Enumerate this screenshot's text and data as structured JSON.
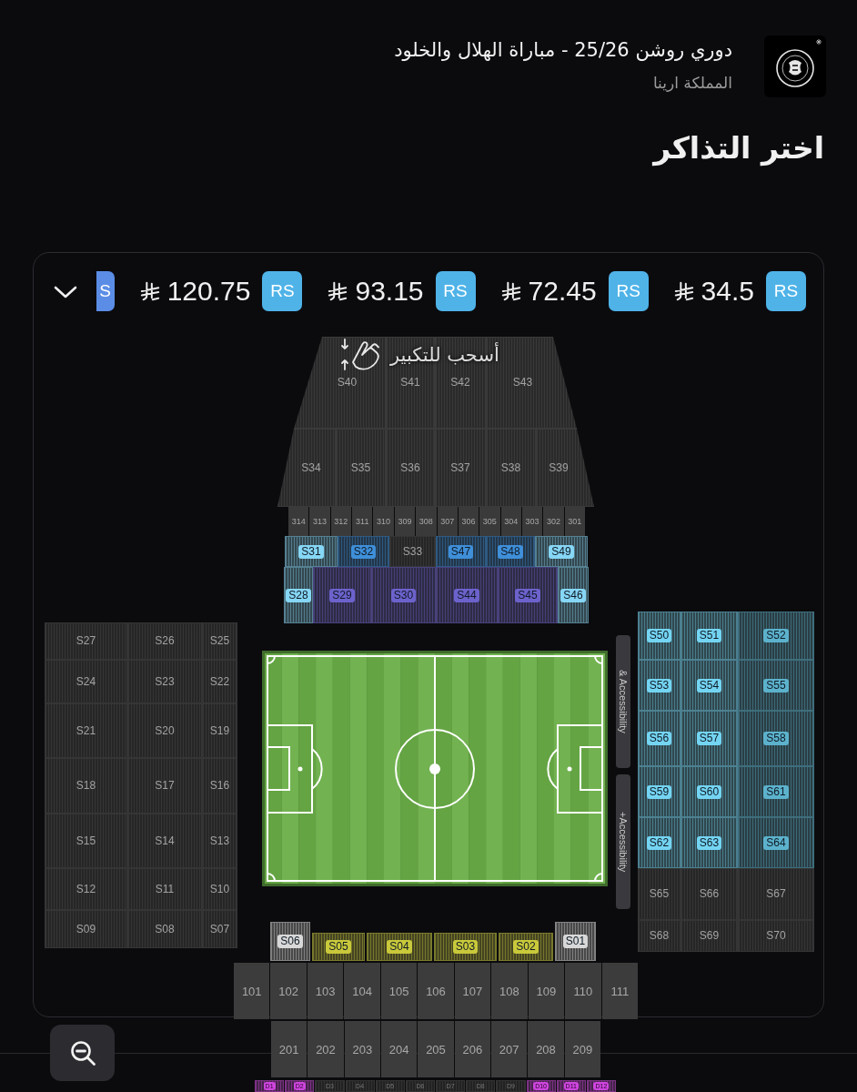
{
  "event": {
    "title": "دوري روشن 25/26 - مباراة الهلال والخلود",
    "venue": "المملكة ارينا"
  },
  "heading": "اختر التذاكر",
  "price_filters": [
    {
      "badge": "S",
      "color": "#5b8de6"
    },
    {
      "badge": "RS",
      "price": "120.75",
      "color": "#4fb3e8"
    },
    {
      "badge": "RS",
      "price": "93.15",
      "color": "#4fb3e8"
    },
    {
      "badge": "RS",
      "price": "72.45",
      "color": "#4fb3e8"
    },
    {
      "badge": "RS",
      "price": "34.5",
      "color": "#4fb3e8"
    }
  ],
  "map": {
    "hint": "أسحب للتكبير",
    "top_stand": {
      "upper_tier": [
        {
          "label": "S40",
          "available": false
        },
        {
          "label": "S41",
          "available": false
        },
        {
          "label": "S42",
          "available": false
        },
        {
          "label": "S43",
          "available": false
        }
      ],
      "lower_tier": [
        {
          "label": "S34",
          "available": false
        },
        {
          "label": "S35",
          "available": false
        },
        {
          "label": "S36",
          "available": false
        },
        {
          "label": "S37",
          "available": false
        },
        {
          "label": "S38",
          "available": false
        },
        {
          "label": "S39",
          "available": false
        }
      ],
      "boxes": [
        {
          "label": "314",
          "available": false
        },
        {
          "label": "313",
          "available": false
        },
        {
          "label": "312",
          "available": false
        },
        {
          "label": "311",
          "available": false
        },
        {
          "label": "310",
          "available": false
        },
        {
          "label": "309",
          "available": false
        },
        {
          "label": "308",
          "available": false
        },
        {
          "label": "307",
          "available": false
        },
        {
          "label": "306",
          "available": false
        },
        {
          "label": "305",
          "available": false
        },
        {
          "label": "304",
          "available": false
        },
        {
          "label": "303",
          "available": false
        },
        {
          "label": "302",
          "available": false
        },
        {
          "label": "301",
          "available": false
        }
      ],
      "front_tier": [
        {
          "label": "S31",
          "available": true,
          "color": "#86d6f5"
        },
        {
          "label": "S32",
          "available": true,
          "color": "#3f8fd9"
        },
        {
          "label": "S33",
          "available": false
        },
        {
          "label": "S47",
          "available": true,
          "color": "#3f8fd9"
        },
        {
          "label": "S48",
          "available": true,
          "color": "#3f8fd9"
        },
        {
          "label": "S49",
          "available": true,
          "color": "#86d6f5"
        }
      ],
      "pitchside_tier": [
        {
          "label": "S28",
          "available": true,
          "color": "#86d6f5"
        },
        {
          "label": "S29",
          "available": true,
          "color": "#6d62cc"
        },
        {
          "label": "S30",
          "available": true,
          "color": "#6d62cc"
        },
        {
          "label": "S44",
          "available": true,
          "color": "#6d62cc"
        },
        {
          "label": "S45",
          "available": true,
          "color": "#6d62cc"
        },
        {
          "label": "S46",
          "available": true,
          "color": "#86d6f5"
        }
      ]
    },
    "left_stand": {
      "rows": [
        [
          {
            "label": "S27",
            "available": false
          },
          {
            "label": "S26",
            "available": false
          },
          {
            "label": "S25",
            "available": false
          }
        ],
        [
          {
            "label": "S24",
            "available": false
          },
          {
            "label": "S23",
            "available": false
          },
          {
            "label": "S22",
            "available": false
          }
        ],
        [
          {
            "label": "S21",
            "available": false
          },
          {
            "label": "S20",
            "available": false
          },
          {
            "label": "S19",
            "available": false
          }
        ],
        [
          {
            "label": "S18",
            "available": false
          },
          {
            "label": "S17",
            "available": false
          },
          {
            "label": "S16",
            "available": false
          }
        ],
        [
          {
            "label": "S15",
            "available": false
          },
          {
            "label": "S14",
            "available": false
          },
          {
            "label": "S13",
            "available": false
          }
        ],
        [
          {
            "label": "S12",
            "available": false
          },
          {
            "label": "S11",
            "available": false
          },
          {
            "label": "S10",
            "available": false
          }
        ],
        [
          {
            "label": "S09",
            "available": false
          },
          {
            "label": "S08",
            "available": false
          },
          {
            "label": "S07",
            "available": false
          }
        ]
      ]
    },
    "side_sections": [
      {
        "label": "& Accessibility"
      },
      {
        "label": "+Accessibility"
      }
    ],
    "right_stand": {
      "rows": [
        [
          {
            "label": "S50",
            "available": true,
            "color": "#74d5f3"
          },
          {
            "label": "S51",
            "available": true,
            "color": "#74d5f3"
          },
          {
            "label": "S52",
            "available": true,
            "color": "#5cb2cc"
          }
        ],
        [
          {
            "label": "S53",
            "available": true,
            "color": "#74d5f3"
          },
          {
            "label": "S54",
            "available": true,
            "color": "#74d5f3"
          },
          {
            "label": "S55",
            "available": true,
            "color": "#5cb2cc"
          }
        ],
        [
          {
            "label": "S56",
            "available": true,
            "color": "#74d5f3"
          },
          {
            "label": "S57",
            "available": true,
            "color": "#74d5f3"
          },
          {
            "label": "S58",
            "available": true,
            "color": "#5cb2cc"
          }
        ],
        [
          {
            "label": "S59",
            "available": true,
            "color": "#74d5f3"
          },
          {
            "label": "S60",
            "available": true,
            "color": "#74d5f3"
          },
          {
            "label": "S61",
            "available": true,
            "color": "#5cb2cc"
          }
        ],
        [
          {
            "label": "S62",
            "available": true,
            "color": "#74d5f3"
          },
          {
            "label": "S63",
            "available": true,
            "color": "#74d5f3"
          },
          {
            "label": "S64",
            "available": true,
            "color": "#5cb2cc"
          }
        ],
        [
          {
            "label": "S65",
            "available": false
          },
          {
            "label": "S66",
            "available": false
          },
          {
            "label": "S67",
            "available": false
          }
        ],
        [
          {
            "label": "S68",
            "available": false
          },
          {
            "label": "S69",
            "available": false
          },
          {
            "label": "S70",
            "available": false
          }
        ]
      ]
    },
    "bottom_stand": {
      "front_sections": [
        {
          "label": "S06",
          "available": true,
          "color": "#d8d8d8"
        },
        {
          "label": "S05",
          "available": true,
          "color": "#c9c93b"
        },
        {
          "label": "S04",
          "available": true,
          "color": "#c9c93b"
        },
        {
          "label": "S03",
          "available": true,
          "color": "#c9c93b"
        },
        {
          "label": "S02",
          "available": true,
          "color": "#c9c93b"
        },
        {
          "label": "S01",
          "available": true,
          "color": "#d8d8d8"
        }
      ],
      "lower_blocks": [
        {
          "label": "101",
          "available": false
        },
        {
          "label": "102",
          "available": false
        },
        {
          "label": "103",
          "available": false
        },
        {
          "label": "104",
          "available": false
        },
        {
          "label": "105",
          "available": false
        },
        {
          "label": "106",
          "available": false
        },
        {
          "label": "107",
          "available": false
        },
        {
          "label": "108",
          "available": false
        },
        {
          "label": "109",
          "available": false
        },
        {
          "label": "110",
          "available": false
        },
        {
          "label": "111",
          "available": false
        }
      ],
      "upper_blocks": [
        {
          "label": "201",
          "available": false
        },
        {
          "label": "202",
          "available": false
        },
        {
          "label": "203",
          "available": false
        },
        {
          "label": "204",
          "available": false
        },
        {
          "label": "205",
          "available": false
        },
        {
          "label": "206",
          "available": false
        },
        {
          "label": "207",
          "available": false
        },
        {
          "label": "208",
          "available": false
        },
        {
          "label": "209",
          "available": false
        }
      ],
      "back_row": [
        {
          "label": "D1",
          "available": true,
          "color": "#cf45df"
        },
        {
          "label": "D2",
          "available": true,
          "color": "#cf45df"
        },
        {
          "label": "D3",
          "available": false
        },
        {
          "label": "D4",
          "available": false
        },
        {
          "label": "D5",
          "available": false
        },
        {
          "label": "D6",
          "available": false
        },
        {
          "label": "D7",
          "available": false
        },
        {
          "label": "D8",
          "available": false
        },
        {
          "label": "D9",
          "available": false
        },
        {
          "label": "D10",
          "available": true,
          "color": "#cf45df"
        },
        {
          "label": "D11",
          "available": true,
          "color": "#cf45df"
        },
        {
          "label": "D12",
          "available": true,
          "color": "#cf45df"
        }
      ]
    }
  }
}
